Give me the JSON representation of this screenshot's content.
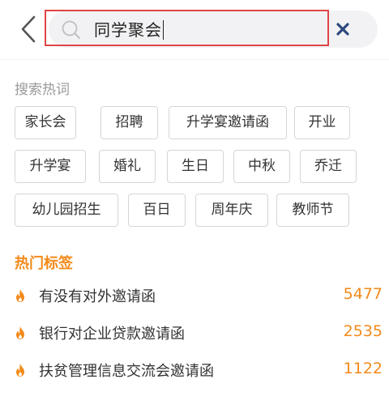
{
  "header": {
    "search_value": "同学聚会",
    "icons": {
      "back": "chevron-left-icon",
      "search": "search-icon",
      "clear": "close-icon"
    }
  },
  "hot_words": {
    "title": "搜索热词",
    "rows": [
      [
        "家长会",
        "招聘",
        "升学宴邀请函",
        "开业"
      ],
      [
        "升学宴",
        "婚礼",
        "生日",
        "中秋",
        "乔迁"
      ],
      [
        "幼儿园招生",
        "百日",
        "周年庆",
        "教师节"
      ]
    ]
  },
  "hot_tags": {
    "title": "热门标签",
    "icon": "fire-icon",
    "items": [
      {
        "label": "有没有对外邀请函",
        "count": "5477"
      },
      {
        "label": "银行对企业贷款邀请函",
        "count": "2535"
      },
      {
        "label": "扶贫管理信息交流会邀请函",
        "count": "1122"
      }
    ]
  },
  "colors": {
    "accent": "#f28a1a",
    "focus_border": "#e04545",
    "clear_icon": "#2c4a7c"
  }
}
